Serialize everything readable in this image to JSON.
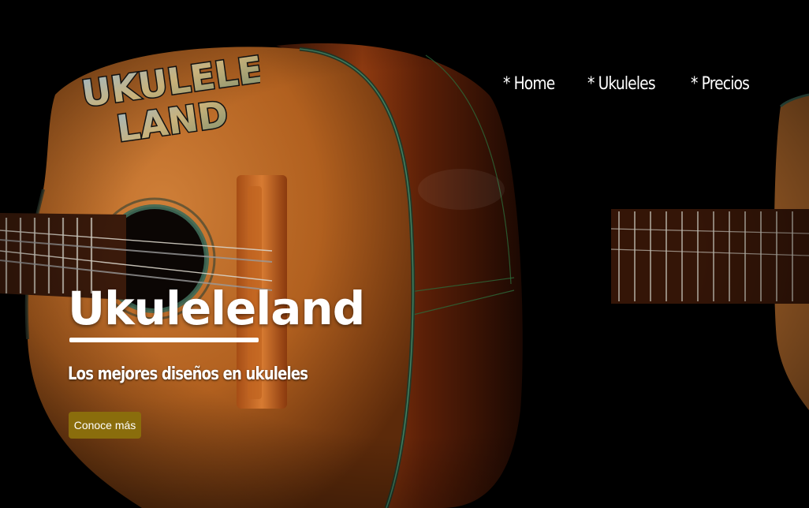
{
  "brand": {
    "logo_line1": "UKULELE",
    "logo_line2": "LAND"
  },
  "nav": {
    "items": [
      {
        "label": "* Home"
      },
      {
        "label": "* Ukuleles"
      },
      {
        "label": "* Precios"
      }
    ]
  },
  "hero": {
    "title": "Ukuleleland",
    "subtitle": "Los mejores diseños en ukuleles",
    "cta_label": "Conoce más"
  },
  "colors": {
    "background": "#000000",
    "cta": "#8a6d0c",
    "text": "#ffffff"
  }
}
